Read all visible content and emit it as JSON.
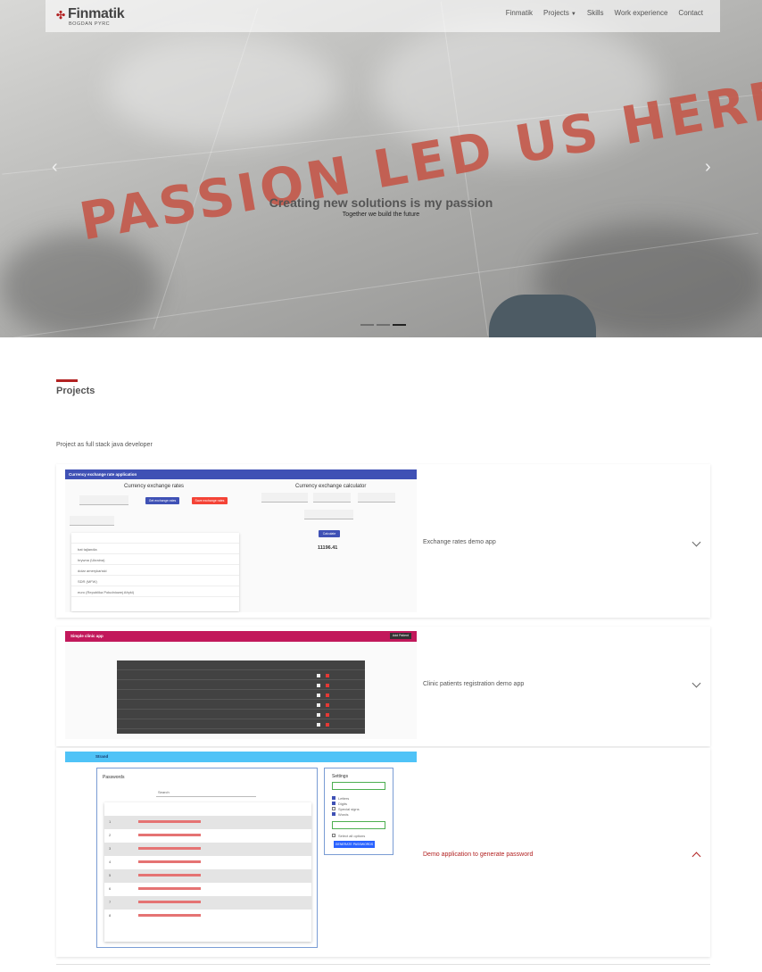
{
  "brand": {
    "name": "Finmatik",
    "subtitle": "BOGDAN PYRC",
    "accent_color": "#b22222"
  },
  "nav": {
    "items": [
      {
        "label": "Finmatik"
      },
      {
        "label": "Projects",
        "has_dropdown": true
      },
      {
        "label": "Skills"
      },
      {
        "label": "Work experience"
      },
      {
        "label": "Contact"
      }
    ]
  },
  "carousel": {
    "caption_title": "Creating new solutions is my passion",
    "caption_subtitle": "Together we build the future",
    "background_text": "PASSION LED US HERE",
    "indicator_count": 3,
    "active_indicator": 3,
    "prev_icon": "chevron-left-icon",
    "next_icon": "chevron-right-icon"
  },
  "projects": {
    "title": "Projects",
    "subtitle": "Project as full stack java developer",
    "panels": [
      {
        "title": "Exchange rates demo app",
        "expanded": false,
        "screenshot": {
          "app_bar": "Currency exchange rate application",
          "left_heading": "Currency exchange rates",
          "right_heading": "Currency exchange calculator",
          "get_button": "Get exchange rates",
          "save_button": "Save exchange rates",
          "calculate_button": "Calculate",
          "result": "11196.41",
          "rows": [
            "bat tajlandia",
            "hrywna (Ukraina)",
            "dolar amerykański",
            "SDR (MFW)",
            "euro (Republika Południowej Afryki)"
          ]
        }
      },
      {
        "title": "Clinic patients registration demo app",
        "expanded": false,
        "screenshot": {
          "app_bar": "Simple clinic app",
          "add_button": "Add Patient",
          "row_count": 6
        }
      },
      {
        "title": "Demo application to generate password",
        "expanded": true,
        "screenshot": {
          "app_bar": "Strand",
          "list_title": "Passwords",
          "search_label": "Search",
          "settings_title": "Settings",
          "options": [
            "Letters",
            "Digits",
            "Special signs",
            "Words"
          ],
          "select_all": "Select all options",
          "generate_button": "GENERATE PASSWORDS",
          "row_count": 8
        }
      }
    ]
  }
}
